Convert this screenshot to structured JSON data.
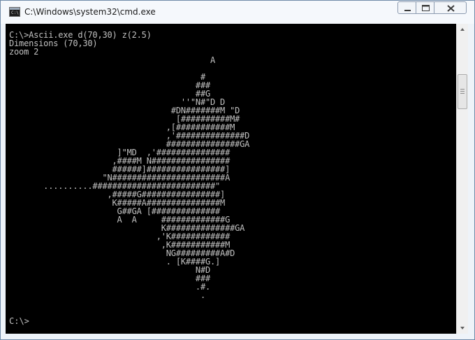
{
  "window": {
    "title": "C:\\Windows\\system32\\cmd.exe",
    "icon": "cmd-icon",
    "icon_glyph": "C:\\"
  },
  "controls": {
    "minimize": "minimize-icon",
    "maximize": "maximize-icon",
    "close": "close-icon"
  },
  "console": {
    "output": "C:\\>Ascii.exe d(70,30) z(2.5)\nDimensions (70,30)\nzoom 2\n                                         A\n\n                                       #\n                                      ###\n                                      ##G\n                                   ''\"N#\"D D\n                                 #DN#######M \"D\n                                  [##########M#\n                                ,[###########M\n                                ,'##############D\n                                ###############GA\n                      ]\"MD  ,'###############\n                     ,####M N################\n                     ######]################]\n                   \"N#######################A\n       ..........#########################\"\n                    ,#####G################]\n                     K#####A###############M\n                      G##GA [##############\n                      A  A     #############G\n                               K##############GA\n                              ,'K############\n                               ,K###########M\n                                NG#########A#D\n                                . [K####G.]\n                                      N#D\n                                      ###\n                                      .#.\n                                       .",
    "prompt": "C:\\>",
    "text_color": "#c0c0c0",
    "background": "#000000"
  },
  "scrollbar": {
    "up_icon": "scroll-up-arrow-icon",
    "down_icon": "scroll-down-arrow-icon"
  }
}
